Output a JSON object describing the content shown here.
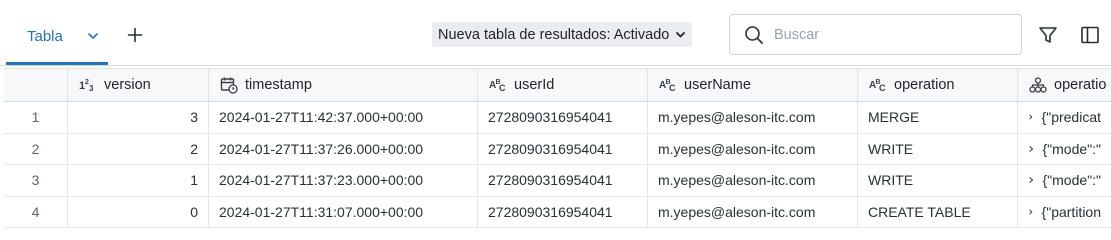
{
  "toolbar": {
    "tab_label": "Tabla",
    "add_tab_label": "+",
    "toggle_label": "Nueva tabla de resultados: Activado",
    "search_placeholder": "Buscar",
    "accent_color": "#2272b4"
  },
  "table": {
    "columns": [
      {
        "label": "version",
        "type_icon": "1²₃"
      },
      {
        "label": "timestamp",
        "type_icon": "calendar-clock-icon"
      },
      {
        "label": "userId",
        "type_icon": "AᴮC"
      },
      {
        "label": "userName",
        "type_icon": "AᴮC"
      },
      {
        "label": "operation",
        "type_icon": "AᴮC"
      },
      {
        "label": "operatio",
        "type_icon": "struct-icon"
      }
    ],
    "rows": [
      {
        "index": "1",
        "version": "3",
        "timestamp": "2024-01-27T11:42:37.000+00:00",
        "userId": "2728090316954041",
        "userName": "m.yepes@aleson-itc.com",
        "operation": "MERGE",
        "params": "{\"predicat"
      },
      {
        "index": "2",
        "version": "2",
        "timestamp": "2024-01-27T11:37:26.000+00:00",
        "userId": "2728090316954041",
        "userName": "m.yepes@aleson-itc.com",
        "operation": "WRITE",
        "params": "{\"mode\":\""
      },
      {
        "index": "3",
        "version": "1",
        "timestamp": "2024-01-27T11:37:23.000+00:00",
        "userId": "2728090316954041",
        "userName": "m.yepes@aleson-itc.com",
        "operation": "WRITE",
        "params": "{\"mode\":\""
      },
      {
        "index": "4",
        "version": "0",
        "timestamp": "2024-01-27T11:31:07.000+00:00",
        "userId": "2728090316954041",
        "userName": "m.yepes@aleson-itc.com",
        "operation": "CREATE TABLE",
        "params": "{\"partition"
      }
    ]
  }
}
